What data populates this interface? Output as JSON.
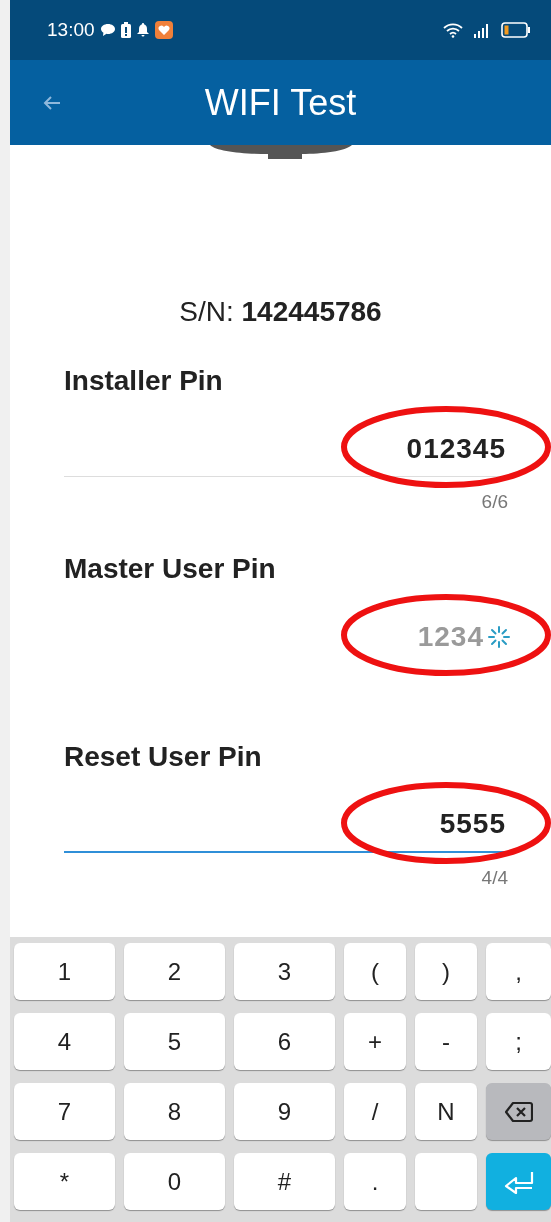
{
  "status_bar": {
    "time": "13:00"
  },
  "app_bar": {
    "title": "WIFI Test"
  },
  "serial": {
    "label": "S/N:",
    "value": "142445786"
  },
  "fields": [
    {
      "label": "Installer Pin",
      "value": "012345",
      "counter": "6/6",
      "focused": false,
      "loading": false,
      "highlighted": true
    },
    {
      "label": "Master User Pin",
      "value": "1234",
      "focused": false,
      "loading": true,
      "highlighted": true
    },
    {
      "label": "Reset User Pin",
      "value": "5555",
      "counter": "4/4",
      "focused": true,
      "loading": false,
      "highlighted": true
    }
  ],
  "keyboard": {
    "rows": [
      [
        {
          "kind": "char",
          "label": "1"
        },
        {
          "kind": "char",
          "label": "2"
        },
        {
          "kind": "char",
          "label": "3"
        },
        {
          "kind": "char",
          "label": "("
        },
        {
          "kind": "char",
          "label": ")"
        },
        {
          "kind": "char",
          "label": ","
        }
      ],
      [
        {
          "kind": "char",
          "label": "4"
        },
        {
          "kind": "char",
          "label": "5"
        },
        {
          "kind": "char",
          "label": "6"
        },
        {
          "kind": "char",
          "label": "+"
        },
        {
          "kind": "char",
          "label": "-"
        },
        {
          "kind": "char",
          "label": ";"
        }
      ],
      [
        {
          "kind": "char",
          "label": "7"
        },
        {
          "kind": "char",
          "label": "8"
        },
        {
          "kind": "char",
          "label": "9"
        },
        {
          "kind": "char",
          "label": "/"
        },
        {
          "kind": "char",
          "label": "N"
        },
        {
          "kind": "backspace"
        }
      ],
      [
        {
          "kind": "char",
          "label": "*"
        },
        {
          "kind": "char",
          "label": "0"
        },
        {
          "kind": "char",
          "label": "#"
        },
        {
          "kind": "char",
          "label": "."
        },
        {
          "kind": "space"
        },
        {
          "kind": "enter"
        }
      ]
    ]
  }
}
